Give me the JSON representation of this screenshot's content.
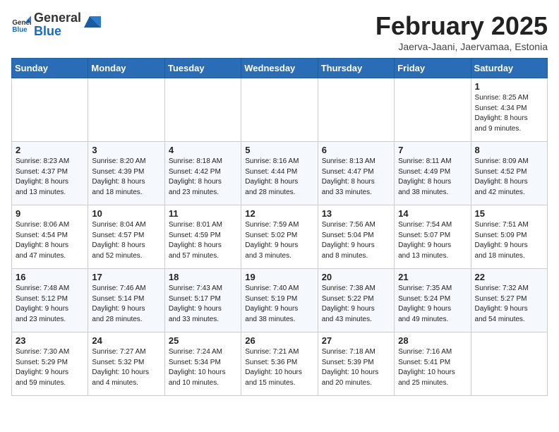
{
  "header": {
    "logo_general": "General",
    "logo_blue": "Blue",
    "title": "February 2025",
    "subtitle": "Jaerva-Jaani, Jaervamaa, Estonia"
  },
  "weekdays": [
    "Sunday",
    "Monday",
    "Tuesday",
    "Wednesday",
    "Thursday",
    "Friday",
    "Saturday"
  ],
  "weeks": [
    [
      {
        "day": "",
        "info": ""
      },
      {
        "day": "",
        "info": ""
      },
      {
        "day": "",
        "info": ""
      },
      {
        "day": "",
        "info": ""
      },
      {
        "day": "",
        "info": ""
      },
      {
        "day": "",
        "info": ""
      },
      {
        "day": "1",
        "info": "Sunrise: 8:25 AM\nSunset: 4:34 PM\nDaylight: 8 hours\nand 9 minutes."
      }
    ],
    [
      {
        "day": "2",
        "info": "Sunrise: 8:23 AM\nSunset: 4:37 PM\nDaylight: 8 hours\nand 13 minutes."
      },
      {
        "day": "3",
        "info": "Sunrise: 8:20 AM\nSunset: 4:39 PM\nDaylight: 8 hours\nand 18 minutes."
      },
      {
        "day": "4",
        "info": "Sunrise: 8:18 AM\nSunset: 4:42 PM\nDaylight: 8 hours\nand 23 minutes."
      },
      {
        "day": "5",
        "info": "Sunrise: 8:16 AM\nSunset: 4:44 PM\nDaylight: 8 hours\nand 28 minutes."
      },
      {
        "day": "6",
        "info": "Sunrise: 8:13 AM\nSunset: 4:47 PM\nDaylight: 8 hours\nand 33 minutes."
      },
      {
        "day": "7",
        "info": "Sunrise: 8:11 AM\nSunset: 4:49 PM\nDaylight: 8 hours\nand 38 minutes."
      },
      {
        "day": "8",
        "info": "Sunrise: 8:09 AM\nSunset: 4:52 PM\nDaylight: 8 hours\nand 42 minutes."
      }
    ],
    [
      {
        "day": "9",
        "info": "Sunrise: 8:06 AM\nSunset: 4:54 PM\nDaylight: 8 hours\nand 47 minutes."
      },
      {
        "day": "10",
        "info": "Sunrise: 8:04 AM\nSunset: 4:57 PM\nDaylight: 8 hours\nand 52 minutes."
      },
      {
        "day": "11",
        "info": "Sunrise: 8:01 AM\nSunset: 4:59 PM\nDaylight: 8 hours\nand 57 minutes."
      },
      {
        "day": "12",
        "info": "Sunrise: 7:59 AM\nSunset: 5:02 PM\nDaylight: 9 hours\nand 3 minutes."
      },
      {
        "day": "13",
        "info": "Sunrise: 7:56 AM\nSunset: 5:04 PM\nDaylight: 9 hours\nand 8 minutes."
      },
      {
        "day": "14",
        "info": "Sunrise: 7:54 AM\nSunset: 5:07 PM\nDaylight: 9 hours\nand 13 minutes."
      },
      {
        "day": "15",
        "info": "Sunrise: 7:51 AM\nSunset: 5:09 PM\nDaylight: 9 hours\nand 18 minutes."
      }
    ],
    [
      {
        "day": "16",
        "info": "Sunrise: 7:48 AM\nSunset: 5:12 PM\nDaylight: 9 hours\nand 23 minutes."
      },
      {
        "day": "17",
        "info": "Sunrise: 7:46 AM\nSunset: 5:14 PM\nDaylight: 9 hours\nand 28 minutes."
      },
      {
        "day": "18",
        "info": "Sunrise: 7:43 AM\nSunset: 5:17 PM\nDaylight: 9 hours\nand 33 minutes."
      },
      {
        "day": "19",
        "info": "Sunrise: 7:40 AM\nSunset: 5:19 PM\nDaylight: 9 hours\nand 38 minutes."
      },
      {
        "day": "20",
        "info": "Sunrise: 7:38 AM\nSunset: 5:22 PM\nDaylight: 9 hours\nand 43 minutes."
      },
      {
        "day": "21",
        "info": "Sunrise: 7:35 AM\nSunset: 5:24 PM\nDaylight: 9 hours\nand 49 minutes."
      },
      {
        "day": "22",
        "info": "Sunrise: 7:32 AM\nSunset: 5:27 PM\nDaylight: 9 hours\nand 54 minutes."
      }
    ],
    [
      {
        "day": "23",
        "info": "Sunrise: 7:30 AM\nSunset: 5:29 PM\nDaylight: 9 hours\nand 59 minutes."
      },
      {
        "day": "24",
        "info": "Sunrise: 7:27 AM\nSunset: 5:32 PM\nDaylight: 10 hours\nand 4 minutes."
      },
      {
        "day": "25",
        "info": "Sunrise: 7:24 AM\nSunset: 5:34 PM\nDaylight: 10 hours\nand 10 minutes."
      },
      {
        "day": "26",
        "info": "Sunrise: 7:21 AM\nSunset: 5:36 PM\nDaylight: 10 hours\nand 15 minutes."
      },
      {
        "day": "27",
        "info": "Sunrise: 7:18 AM\nSunset: 5:39 PM\nDaylight: 10 hours\nand 20 minutes."
      },
      {
        "day": "28",
        "info": "Sunrise: 7:16 AM\nSunset: 5:41 PM\nDaylight: 10 hours\nand 25 minutes."
      },
      {
        "day": "",
        "info": ""
      }
    ]
  ]
}
